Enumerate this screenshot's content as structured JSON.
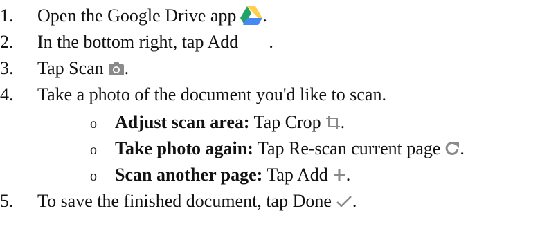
{
  "steps": [
    {
      "num": "1.",
      "text": "Open the Google Drive app",
      "icon": "google-drive-icon",
      "suffix": "."
    },
    {
      "num": "2.",
      "text": "In the bottom right, tap Add",
      "suffix": "."
    },
    {
      "num": "3.",
      "text": "Tap Scan",
      "icon": "camera-icon",
      "suffix": "."
    },
    {
      "num": "4.",
      "text": "Take a photo of the document you'd like to scan."
    },
    {
      "num": "5.",
      "text": "To save the finished document, tap Done",
      "icon": "checkmark-icon",
      "suffix": "."
    }
  ],
  "substeps": [
    {
      "bullet": "o",
      "bold": "Adjust scan area:",
      "text": "Tap Crop",
      "icon": "crop-icon",
      "suffix": "."
    },
    {
      "bullet": "o",
      "bold": "Take photo again:",
      "text": "Tap Re-scan current page",
      "icon": "refresh-icon",
      "suffix": "."
    },
    {
      "bullet": "o",
      "bold": "Scan another page:",
      "text": "Tap Add",
      "icon": "plus-icon",
      "suffix": "."
    }
  ],
  "colors": {
    "icon_gray": "#8a8a8a",
    "drive_green": "#1fa463",
    "drive_yellow": "#ffd04b",
    "drive_blue": "#4688f4"
  }
}
